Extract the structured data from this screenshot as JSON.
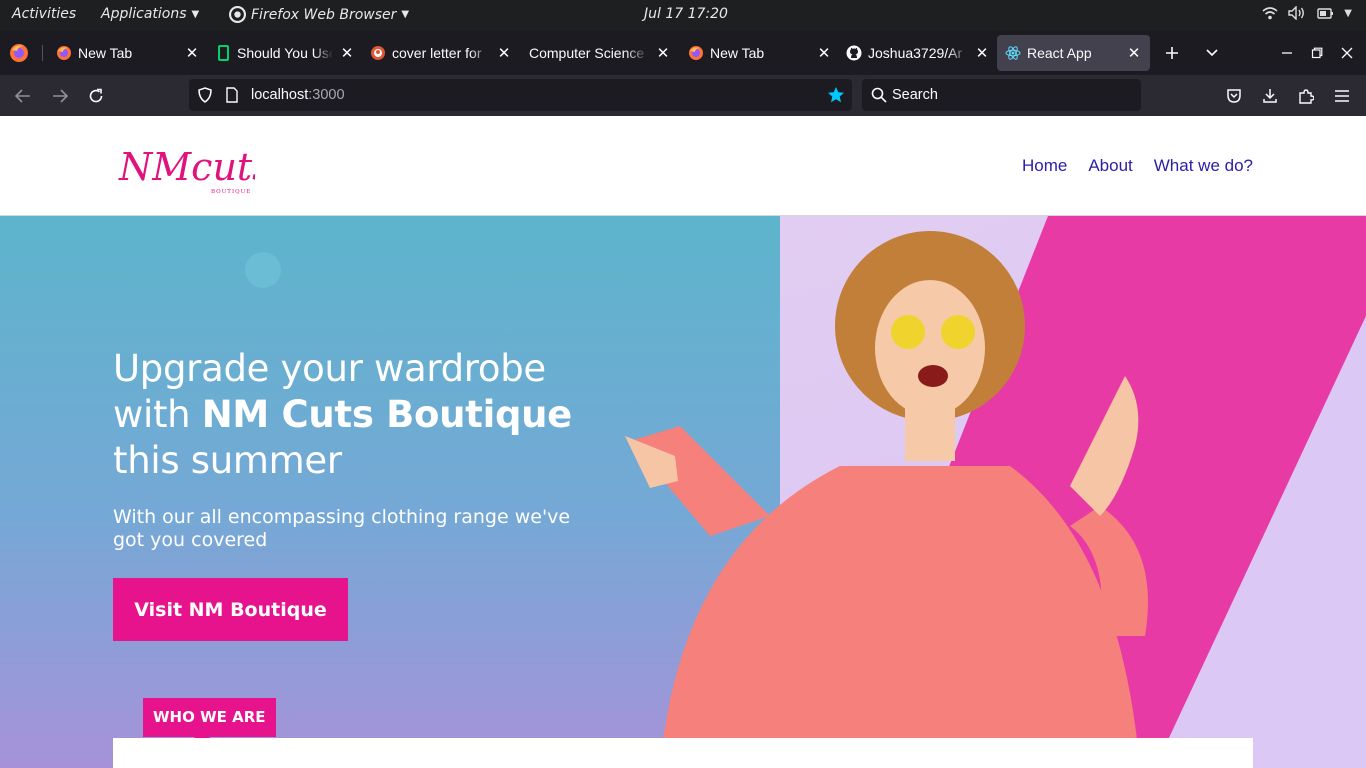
{
  "system": {
    "activities": "Activities",
    "applications": "Applications",
    "app_name": "Firefox Web Browser",
    "datetime": "Jul 17  17:20",
    "icons": [
      "wifi-icon",
      "volume-icon",
      "battery-icon",
      "chevron-down-icon"
    ]
  },
  "tabs": [
    {
      "title": "New Tab",
      "icon": "firefox-icon",
      "active": false
    },
    {
      "title": "Should You Use",
      "icon": "document-icon",
      "active": false
    },
    {
      "title": "cover letter for",
      "icon": "duckduckgo-icon",
      "active": false
    },
    {
      "title": "Computer Science",
      "icon": "none",
      "active": false
    },
    {
      "title": "New Tab",
      "icon": "firefox-icon",
      "active": false
    },
    {
      "title": "Joshua3729/Ar",
      "icon": "github-icon",
      "active": false
    },
    {
      "title": "React App",
      "icon": "react-icon",
      "active": true
    }
  ],
  "navbar": {
    "url_host": "localhost",
    "url_port": ":3000",
    "search_placeholder": "Search"
  },
  "site": {
    "logo_text": "NMcuts",
    "logo_sub": "BOUTIQUE",
    "nav": [
      "Home",
      "About",
      "What we do?"
    ],
    "hero": {
      "title_part1": "Upgrade your wardrobe with ",
      "title_bold": "NM Cuts Boutique",
      "title_part2": " this summer",
      "subtitle": "With our all encompassing clothing range we've got you covered",
      "cta": "Visit NM Boutique"
    },
    "section_badge": "WHO WE ARE"
  },
  "colors": {
    "accent": "#e6138c",
    "nav_link": "#2b20a8",
    "hero_blue": "#5db4cc",
    "hero_lilac": "#d6c3f1"
  }
}
